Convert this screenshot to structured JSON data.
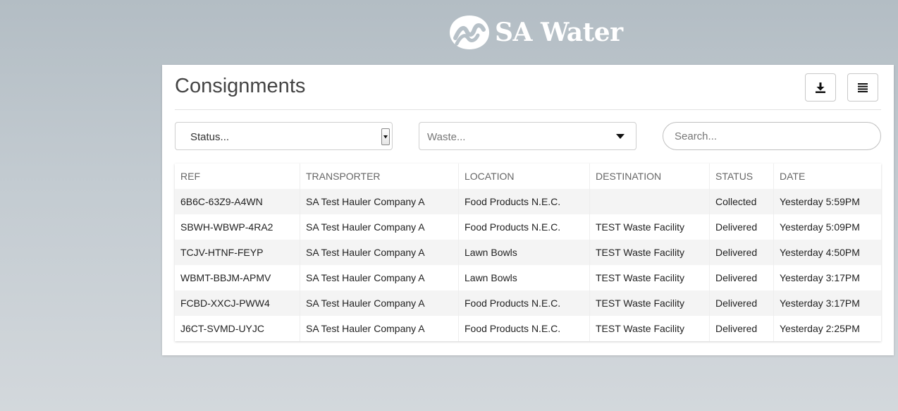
{
  "brand": {
    "name": "SA Water",
    "logo_icon": "sa-water-wave-logo-icon",
    "colors": {
      "text": "#ffffff",
      "background": "#b7c1c8"
    }
  },
  "panel": {
    "title": "Consignments",
    "toolbar": {
      "download_icon": "download-icon",
      "menu_icon": "list-menu-icon"
    }
  },
  "filters": {
    "status": {
      "value": "Status..."
    },
    "waste": {
      "value": "Waste..."
    },
    "search": {
      "placeholder": "Search...",
      "value": ""
    }
  },
  "table": {
    "columns": {
      "ref": "REF",
      "transporter": "TRANSPORTER",
      "location": "LOCATION",
      "destination": "DESTINATION",
      "status": "STATUS",
      "date": "DATE"
    },
    "rows": [
      {
        "ref": "6B6C-63Z9-A4WN",
        "transporter": "SA Test Hauler Company A",
        "location": "Food Products N.E.C.",
        "destination": "",
        "status": "Collected",
        "date": "Yesterday 5:59PM"
      },
      {
        "ref": "SBWH-WBWP-4RA2",
        "transporter": "SA Test Hauler Company A",
        "location": "Food Products N.E.C.",
        "destination": "TEST Waste Facility",
        "status": "Delivered",
        "date": "Yesterday 5:09PM"
      },
      {
        "ref": "TCJV-HTNF-FEYP",
        "transporter": "SA Test Hauler Company A",
        "location": "Lawn Bowls",
        "destination": "TEST Waste Facility",
        "status": "Delivered",
        "date": "Yesterday 4:50PM"
      },
      {
        "ref": "WBMT-BBJM-APMV",
        "transporter": "SA Test Hauler Company A",
        "location": "Lawn Bowls",
        "destination": "TEST Waste Facility",
        "status": "Delivered",
        "date": "Yesterday 3:17PM"
      },
      {
        "ref": "FCBD-XXCJ-PWW4",
        "transporter": "SA Test Hauler Company A",
        "location": "Food Products N.E.C.",
        "destination": "TEST Waste Facility",
        "status": "Delivered",
        "date": "Yesterday 3:17PM"
      },
      {
        "ref": "J6CT-SVMD-UYJC",
        "transporter": "SA Test Hauler Company A",
        "location": "Food Products N.E.C.",
        "destination": "TEST Waste Facility",
        "status": "Delivered",
        "date": "Yesterday 2:25PM"
      }
    ]
  }
}
